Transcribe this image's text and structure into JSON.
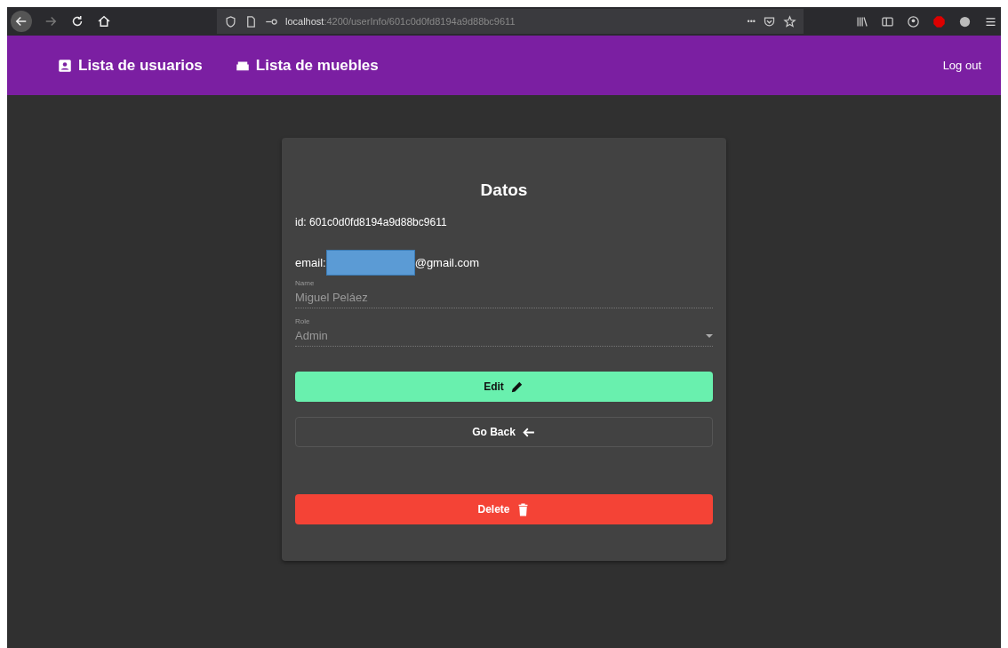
{
  "browser": {
    "url_host": "localhost",
    "url_path": ":4200/userInfo/601c0d0fd8194a9d88bc9611",
    "menu_dots": "•••"
  },
  "navbar": {
    "links": [
      {
        "label": "Lista de usuarios",
        "kind": "users"
      },
      {
        "label": "Lista de muebles",
        "kind": "furniture"
      }
    ],
    "logout": "Log out"
  },
  "card": {
    "title": "Datos",
    "id_line": "id: 601c0d0fd8194a9d88bc9611",
    "email_label": "email:",
    "email_suffix": "@gmail.com",
    "fields": [
      {
        "label": "Name",
        "value": "Miguel Peláez",
        "kind": "text",
        "disabled": true
      },
      {
        "label": "Role",
        "value": "Admin",
        "kind": "select",
        "disabled": true
      }
    ],
    "buttons": [
      {
        "label": "Edit",
        "kind": "edit"
      },
      {
        "label": "Go Back",
        "kind": "back"
      },
      {
        "label": "Delete",
        "kind": "delete"
      }
    ]
  }
}
